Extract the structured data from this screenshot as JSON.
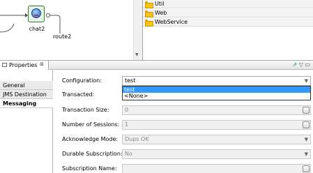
{
  "diagram": {
    "node_label": "chat2",
    "route_label": "route2"
  },
  "tree": {
    "items": [
      {
        "label": "Util"
      },
      {
        "label": "Web"
      },
      {
        "label": "WebService"
      }
    ]
  },
  "properties": {
    "tab_label": "Properties",
    "close_glyph": "⊠",
    "vertical_tabs": [
      "General",
      "JMS Destination",
      "Messaging"
    ],
    "active_tab": "Messaging",
    "fields": {
      "configuration": {
        "label": "Configuration:",
        "value": "test"
      },
      "transacted": {
        "label": "Transacted:"
      },
      "transaction_size": {
        "label": "Transaction Size:",
        "value": "0"
      },
      "sessions": {
        "label": "Number of Sessions:",
        "value": "1"
      },
      "ack_mode": {
        "label": "Acknowledge Mode:",
        "value": "Dups OK"
      },
      "durable": {
        "label": "Durable Subscription:",
        "value": "No"
      },
      "subscription_name": {
        "label": "Subscription Name:",
        "value": ""
      }
    },
    "dropdown_options": [
      "test",
      "<None>"
    ],
    "dropdown_selected": "test"
  }
}
